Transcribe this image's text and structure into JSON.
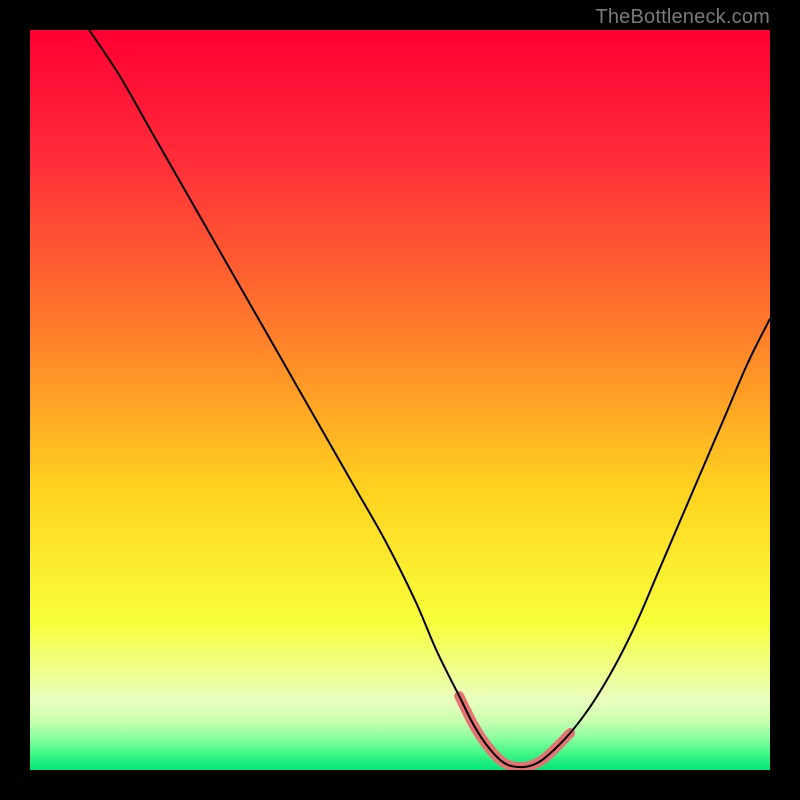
{
  "attribution": "TheBottleneck.com",
  "colors": {
    "frame": "#000000",
    "curve": "#000000",
    "highlight": "#e57373",
    "gradient_stops": [
      {
        "offset": 0.0,
        "color": "#ff0033"
      },
      {
        "offset": 0.18,
        "color": "#ff2e3a"
      },
      {
        "offset": 0.4,
        "color": "#ff7a2b"
      },
      {
        "offset": 0.62,
        "color": "#ffd21f"
      },
      {
        "offset": 0.8,
        "color": "#f8ff3a"
      },
      {
        "offset": 0.905,
        "color": "#eaffbf"
      },
      {
        "offset": 0.932,
        "color": "#ccffb0"
      },
      {
        "offset": 0.955,
        "color": "#8fffa2"
      },
      {
        "offset": 0.978,
        "color": "#40f785"
      },
      {
        "offset": 1.0,
        "color": "#00e57a"
      }
    ]
  },
  "chart_data": {
    "type": "line",
    "title": "",
    "xlabel": "",
    "ylabel": "",
    "xlim": [
      0,
      100
    ],
    "ylim": [
      0,
      100
    ],
    "grid": false,
    "series": [
      {
        "name": "bottleneck-curve",
        "x": [
          8,
          12,
          16,
          20,
          24,
          28,
          32,
          36,
          40,
          44,
          48,
          52,
          55,
          58,
          60,
          62,
          64,
          66,
          68,
          70,
          73,
          76,
          79,
          82,
          85,
          88,
          91,
          94,
          97,
          100
        ],
        "y": [
          100,
          94,
          87,
          80,
          73,
          66,
          59,
          52,
          45,
          38,
          31,
          23,
          16,
          10,
          6,
          3,
          1,
          0.4,
          0.7,
          2,
          5,
          9,
          14,
          20,
          27,
          34,
          41,
          48,
          55,
          61
        ]
      }
    ],
    "annotations": [
      {
        "name": "sweet-spot",
        "x_range": [
          55.5,
          74.5
        ],
        "note": "thick highlight along curve bottom"
      }
    ]
  }
}
